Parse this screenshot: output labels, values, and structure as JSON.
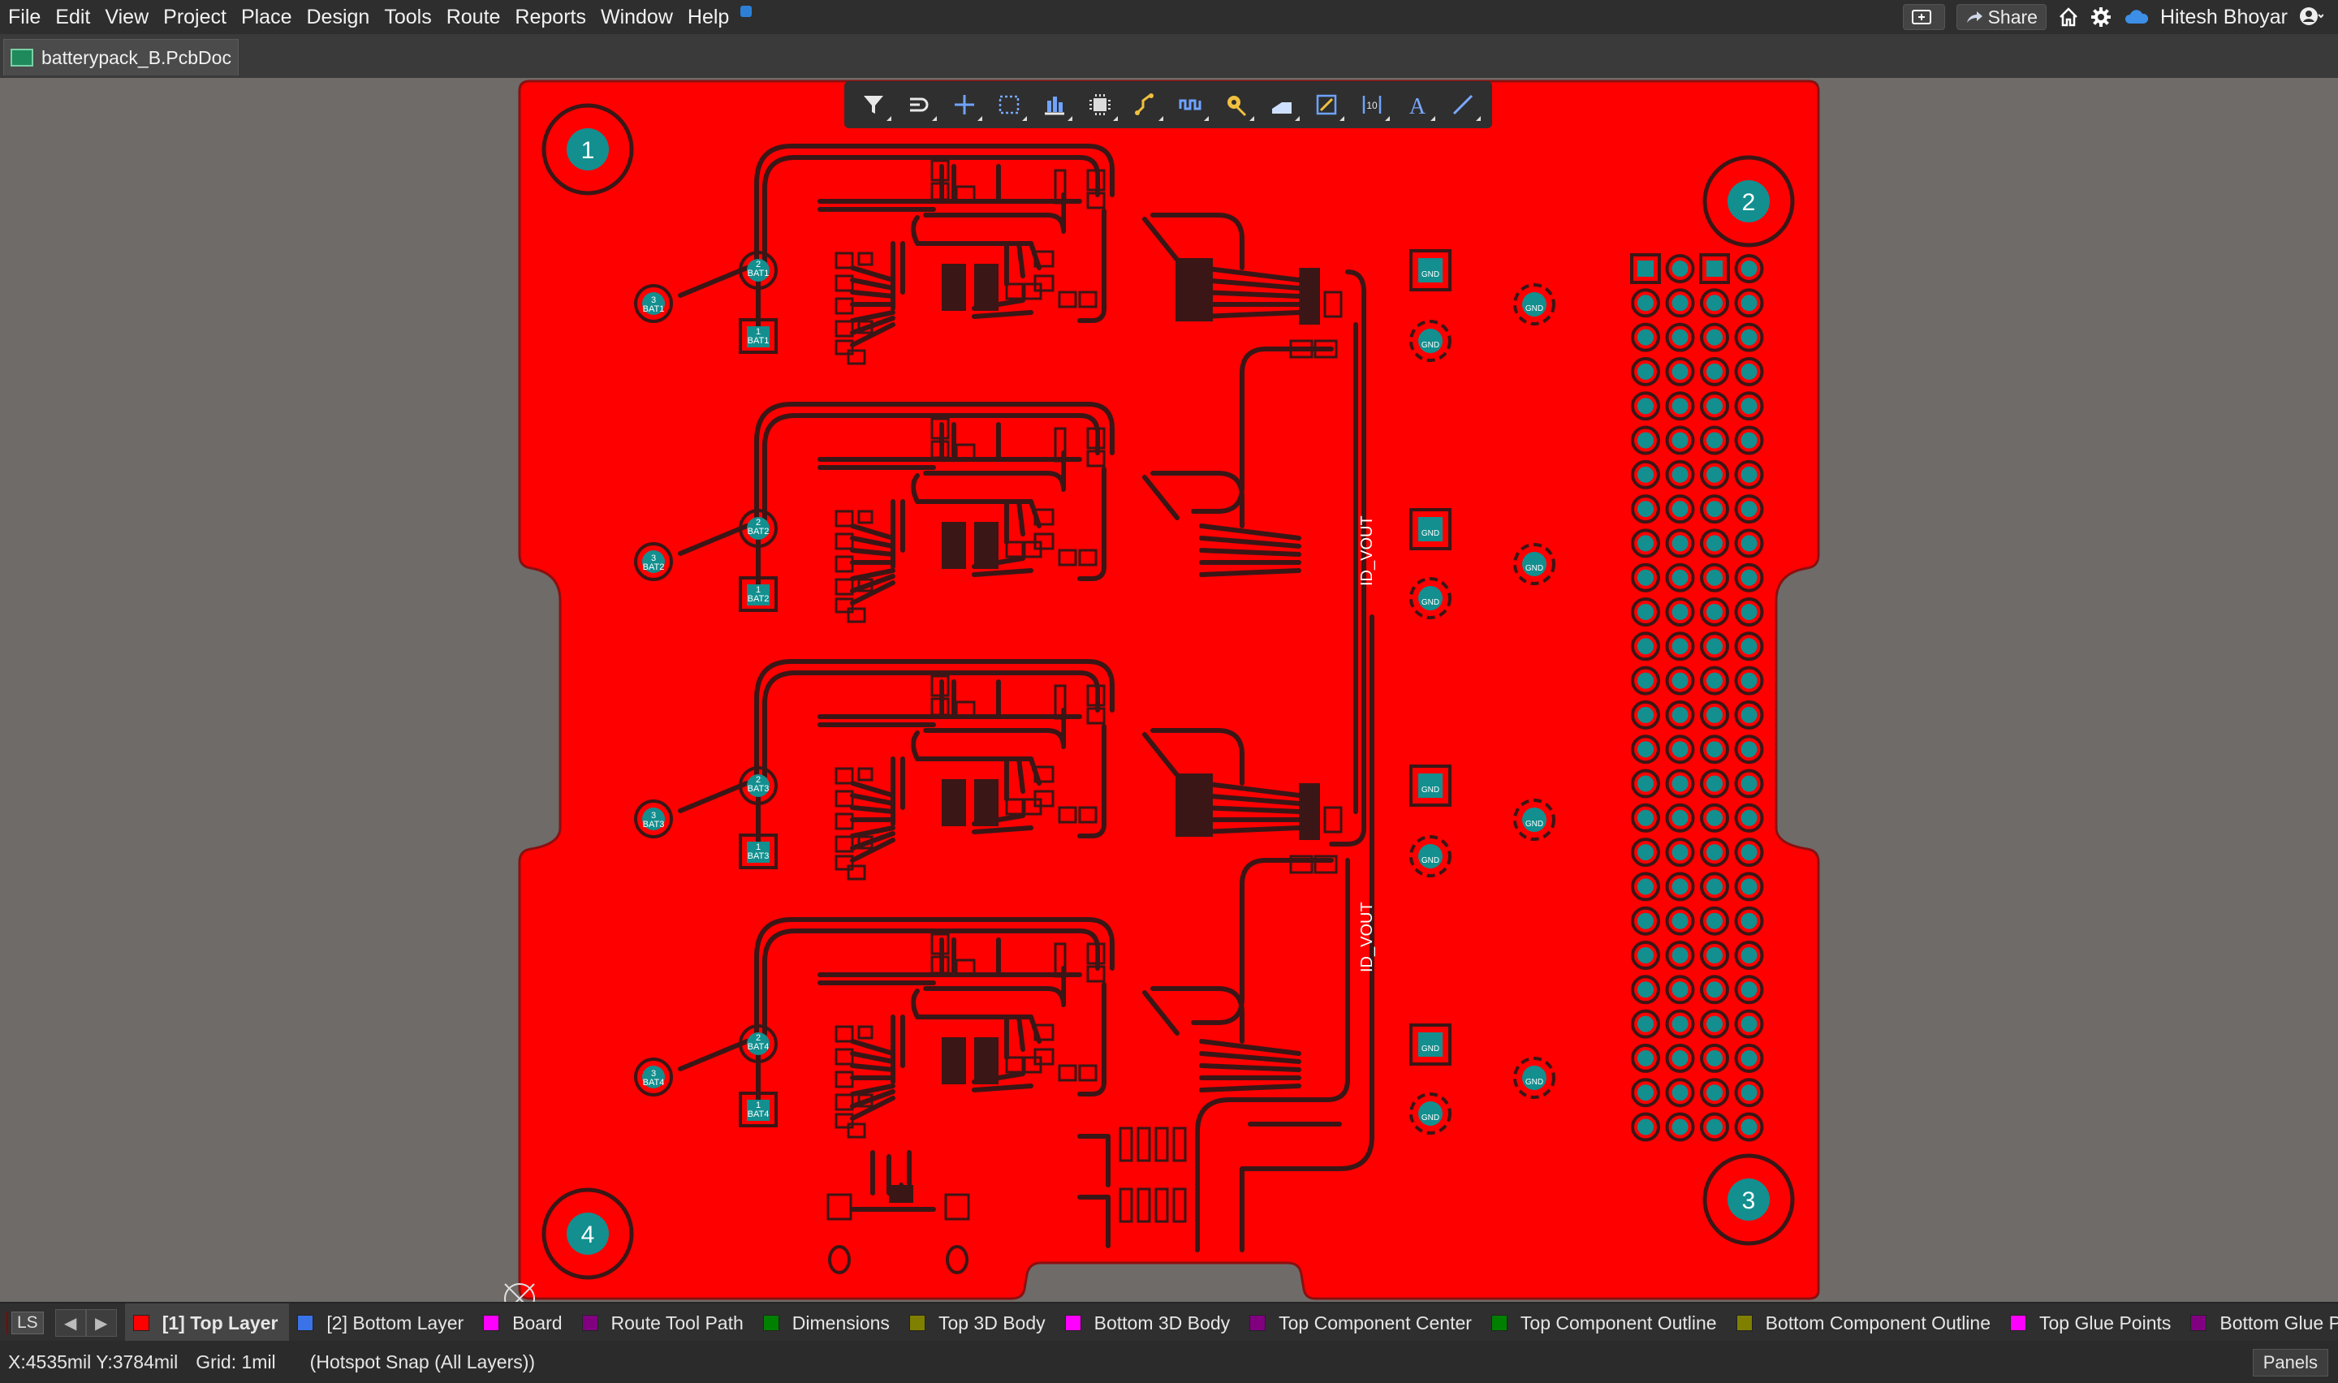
{
  "menubar": {
    "items": [
      "File",
      "Edit",
      "View",
      "Project",
      "Place",
      "Design",
      "Tools",
      "Route",
      "Reports",
      "Window",
      "Help"
    ],
    "share_label": "Share",
    "user_name": "Hitesh Bhoyar"
  },
  "document_tab": {
    "label": "batterypack_B.PcbDoc"
  },
  "pcb": {
    "mounting_holes": [
      "1",
      "2",
      "3",
      "4"
    ],
    "net_labels": [
      "ID_VOUT",
      "ID_VOUT"
    ],
    "battery_pads": [
      {
        "p1": "1",
        "n1": "BAT1",
        "p2": "2",
        "n2": "BAT1",
        "p3": "3",
        "n3": "BAT1"
      },
      {
        "p1": "1",
        "n1": "BAT2",
        "p2": "2",
        "n2": "BAT2",
        "p3": "3",
        "n3": "BAT2"
      },
      {
        "p1": "1",
        "n1": "BAT3",
        "p2": "2",
        "n2": "BAT3",
        "p3": "3",
        "n3": "BAT3"
      },
      {
        "p1": "1",
        "n1": "BAT4",
        "p2": "2",
        "n2": "BAT4",
        "p3": "3",
        "n3": "BAT4"
      }
    ],
    "gnd_label": "GND",
    "board_color": "#ff0000",
    "pad_color": "#138f8f"
  },
  "layers": {
    "current_swatch_label": "LS",
    "tabs": [
      {
        "label": "[1] Top Layer",
        "color": "#ff0000"
      },
      {
        "label": "[2] Bottom Layer",
        "color": "#3a73e8"
      },
      {
        "label": "Board",
        "color": "#ff00ff"
      },
      {
        "label": "Route Tool Path",
        "color": "#800080"
      },
      {
        "label": "Dimensions",
        "color": "#008000"
      },
      {
        "label": "Top 3D Body",
        "color": "#808000"
      },
      {
        "label": "Bottom 3D Body",
        "color": "#ff00ff"
      },
      {
        "label": "Top Component Center",
        "color": "#800080"
      },
      {
        "label": "Top Component Outline",
        "color": "#008000"
      },
      {
        "label": "Bottom Component Outline",
        "color": "#808000"
      },
      {
        "label": "Top Glue Points",
        "color": "#ff00ff"
      },
      {
        "label": "Bottom Glue Points",
        "color": "#800080"
      }
    ]
  },
  "status": {
    "coords": "X:4535mil Y:3784mil",
    "grid": "Grid: 1mil",
    "snap": "(Hotspot Snap (All Layers))",
    "panels_label": "Panels"
  }
}
